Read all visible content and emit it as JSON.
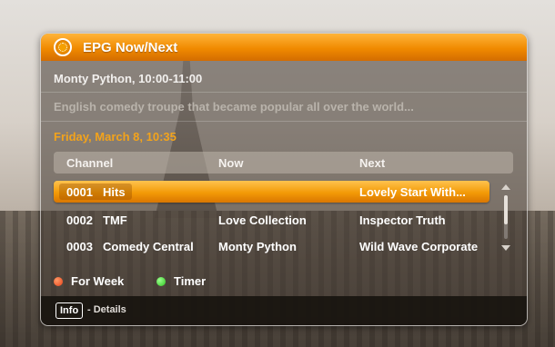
{
  "window": {
    "title": "EPG Now/Next",
    "icon": "epg-icon"
  },
  "program": {
    "title": "Monty Python, 10:00-11:00",
    "description": "English comedy troupe that became popular all over the world..."
  },
  "date": "Friday, March 8, 10:35",
  "table": {
    "headers": [
      "Channel",
      "Now",
      "Next"
    ],
    "rows": [
      {
        "number": "0001",
        "name": "Hits",
        "now": "",
        "next": "Lovely Start With...",
        "selected": true
      },
      {
        "number": "0002",
        "name": "TMF",
        "now": "Love Collection",
        "next": "Inspector Truth",
        "selected": false
      },
      {
        "number": "0003",
        "name": "Comedy Central",
        "now": "Monty Python",
        "next": "Wild Wave Corporate",
        "selected": false
      }
    ]
  },
  "legend": [
    {
      "color": "#e8421a",
      "label": "For Week"
    },
    {
      "color": "#2dc51e",
      "label": "Timer"
    }
  ],
  "footer": {
    "key": "Info",
    "text": "- Details"
  },
  "colors": {
    "accent": "#f08a00",
    "date": "#f3a31b"
  }
}
